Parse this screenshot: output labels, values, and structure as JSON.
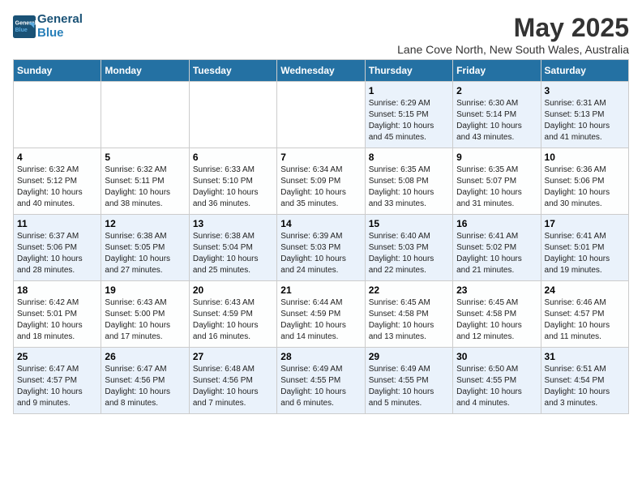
{
  "header": {
    "logo_line1": "General",
    "logo_line2": "Blue",
    "month": "May 2025",
    "location": "Lane Cove North, New South Wales, Australia"
  },
  "days_of_week": [
    "Sunday",
    "Monday",
    "Tuesday",
    "Wednesday",
    "Thursday",
    "Friday",
    "Saturday"
  ],
  "weeks": [
    [
      {
        "day": "",
        "detail": ""
      },
      {
        "day": "",
        "detail": ""
      },
      {
        "day": "",
        "detail": ""
      },
      {
        "day": "",
        "detail": ""
      },
      {
        "day": "1",
        "detail": "Sunrise: 6:29 AM\nSunset: 5:15 PM\nDaylight: 10 hours\nand 45 minutes."
      },
      {
        "day": "2",
        "detail": "Sunrise: 6:30 AM\nSunset: 5:14 PM\nDaylight: 10 hours\nand 43 minutes."
      },
      {
        "day": "3",
        "detail": "Sunrise: 6:31 AM\nSunset: 5:13 PM\nDaylight: 10 hours\nand 41 minutes."
      }
    ],
    [
      {
        "day": "4",
        "detail": "Sunrise: 6:32 AM\nSunset: 5:12 PM\nDaylight: 10 hours\nand 40 minutes."
      },
      {
        "day": "5",
        "detail": "Sunrise: 6:32 AM\nSunset: 5:11 PM\nDaylight: 10 hours\nand 38 minutes."
      },
      {
        "day": "6",
        "detail": "Sunrise: 6:33 AM\nSunset: 5:10 PM\nDaylight: 10 hours\nand 36 minutes."
      },
      {
        "day": "7",
        "detail": "Sunrise: 6:34 AM\nSunset: 5:09 PM\nDaylight: 10 hours\nand 35 minutes."
      },
      {
        "day": "8",
        "detail": "Sunrise: 6:35 AM\nSunset: 5:08 PM\nDaylight: 10 hours\nand 33 minutes."
      },
      {
        "day": "9",
        "detail": "Sunrise: 6:35 AM\nSunset: 5:07 PM\nDaylight: 10 hours\nand 31 minutes."
      },
      {
        "day": "10",
        "detail": "Sunrise: 6:36 AM\nSunset: 5:06 PM\nDaylight: 10 hours\nand 30 minutes."
      }
    ],
    [
      {
        "day": "11",
        "detail": "Sunrise: 6:37 AM\nSunset: 5:06 PM\nDaylight: 10 hours\nand 28 minutes."
      },
      {
        "day": "12",
        "detail": "Sunrise: 6:38 AM\nSunset: 5:05 PM\nDaylight: 10 hours\nand 27 minutes."
      },
      {
        "day": "13",
        "detail": "Sunrise: 6:38 AM\nSunset: 5:04 PM\nDaylight: 10 hours\nand 25 minutes."
      },
      {
        "day": "14",
        "detail": "Sunrise: 6:39 AM\nSunset: 5:03 PM\nDaylight: 10 hours\nand 24 minutes."
      },
      {
        "day": "15",
        "detail": "Sunrise: 6:40 AM\nSunset: 5:03 PM\nDaylight: 10 hours\nand 22 minutes."
      },
      {
        "day": "16",
        "detail": "Sunrise: 6:41 AM\nSunset: 5:02 PM\nDaylight: 10 hours\nand 21 minutes."
      },
      {
        "day": "17",
        "detail": "Sunrise: 6:41 AM\nSunset: 5:01 PM\nDaylight: 10 hours\nand 19 minutes."
      }
    ],
    [
      {
        "day": "18",
        "detail": "Sunrise: 6:42 AM\nSunset: 5:01 PM\nDaylight: 10 hours\nand 18 minutes."
      },
      {
        "day": "19",
        "detail": "Sunrise: 6:43 AM\nSunset: 5:00 PM\nDaylight: 10 hours\nand 17 minutes."
      },
      {
        "day": "20",
        "detail": "Sunrise: 6:43 AM\nSunset: 4:59 PM\nDaylight: 10 hours\nand 16 minutes."
      },
      {
        "day": "21",
        "detail": "Sunrise: 6:44 AM\nSunset: 4:59 PM\nDaylight: 10 hours\nand 14 minutes."
      },
      {
        "day": "22",
        "detail": "Sunrise: 6:45 AM\nSunset: 4:58 PM\nDaylight: 10 hours\nand 13 minutes."
      },
      {
        "day": "23",
        "detail": "Sunrise: 6:45 AM\nSunset: 4:58 PM\nDaylight: 10 hours\nand 12 minutes."
      },
      {
        "day": "24",
        "detail": "Sunrise: 6:46 AM\nSunset: 4:57 PM\nDaylight: 10 hours\nand 11 minutes."
      }
    ],
    [
      {
        "day": "25",
        "detail": "Sunrise: 6:47 AM\nSunset: 4:57 PM\nDaylight: 10 hours\nand 9 minutes."
      },
      {
        "day": "26",
        "detail": "Sunrise: 6:47 AM\nSunset: 4:56 PM\nDaylight: 10 hours\nand 8 minutes."
      },
      {
        "day": "27",
        "detail": "Sunrise: 6:48 AM\nSunset: 4:56 PM\nDaylight: 10 hours\nand 7 minutes."
      },
      {
        "day": "28",
        "detail": "Sunrise: 6:49 AM\nSunset: 4:55 PM\nDaylight: 10 hours\nand 6 minutes."
      },
      {
        "day": "29",
        "detail": "Sunrise: 6:49 AM\nSunset: 4:55 PM\nDaylight: 10 hours\nand 5 minutes."
      },
      {
        "day": "30",
        "detail": "Sunrise: 6:50 AM\nSunset: 4:55 PM\nDaylight: 10 hours\nand 4 minutes."
      },
      {
        "day": "31",
        "detail": "Sunrise: 6:51 AM\nSunset: 4:54 PM\nDaylight: 10 hours\nand 3 minutes."
      }
    ]
  ]
}
